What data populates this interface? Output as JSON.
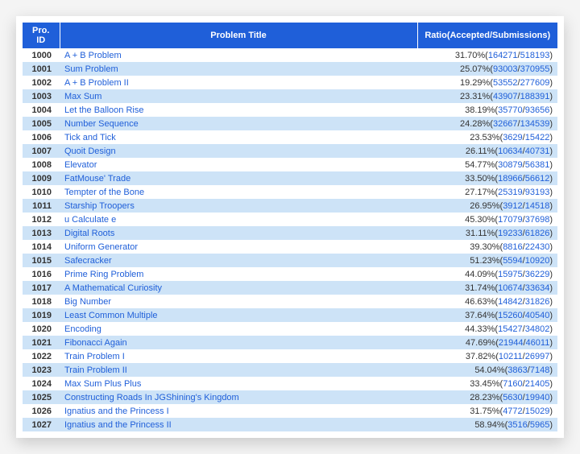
{
  "columns": {
    "id": "Pro. ID",
    "title": "Problem Title",
    "ratio": "Ratio(Accepted/Submissions)"
  },
  "rows": [
    {
      "id": "1000",
      "title": "A + B Problem",
      "ratio": "31.70%",
      "accepted": "164271",
      "submissions": "518193"
    },
    {
      "id": "1001",
      "title": "Sum Problem",
      "ratio": "25.07%",
      "accepted": "93003",
      "submissions": "370955"
    },
    {
      "id": "1002",
      "title": "A + B Problem II",
      "ratio": "19.29%",
      "accepted": "53552",
      "submissions": "277609"
    },
    {
      "id": "1003",
      "title": "Max Sum",
      "ratio": "23.31%",
      "accepted": "43907",
      "submissions": "188391"
    },
    {
      "id": "1004",
      "title": "Let the Balloon Rise",
      "ratio": "38.19%",
      "accepted": "35770",
      "submissions": "93656"
    },
    {
      "id": "1005",
      "title": "Number Sequence",
      "ratio": "24.28%",
      "accepted": "32667",
      "submissions": "134539"
    },
    {
      "id": "1006",
      "title": "Tick and Tick",
      "ratio": "23.53%",
      "accepted": "3629",
      "submissions": "15422"
    },
    {
      "id": "1007",
      "title": "Quoit Design",
      "ratio": "26.11%",
      "accepted": "10634",
      "submissions": "40731"
    },
    {
      "id": "1008",
      "title": "Elevator",
      "ratio": "54.77%",
      "accepted": "30879",
      "submissions": "56381"
    },
    {
      "id": "1009",
      "title": "FatMouse' Trade",
      "ratio": "33.50%",
      "accepted": "18966",
      "submissions": "56612"
    },
    {
      "id": "1010",
      "title": "Tempter of the Bone",
      "ratio": "27.17%",
      "accepted": "25319",
      "submissions": "93193"
    },
    {
      "id": "1011",
      "title": "Starship Troopers",
      "ratio": "26.95%",
      "accepted": "3912",
      "submissions": "14518"
    },
    {
      "id": "1012",
      "title": "u Calculate e",
      "ratio": "45.30%",
      "accepted": "17079",
      "submissions": "37698"
    },
    {
      "id": "1013",
      "title": "Digital Roots",
      "ratio": "31.11%",
      "accepted": "19233",
      "submissions": "61826"
    },
    {
      "id": "1014",
      "title": "Uniform Generator",
      "ratio": "39.30%",
      "accepted": "8816",
      "submissions": "22430"
    },
    {
      "id": "1015",
      "title": "Safecracker",
      "ratio": "51.23%",
      "accepted": "5594",
      "submissions": "10920"
    },
    {
      "id": "1016",
      "title": "Prime Ring Problem",
      "ratio": "44.09%",
      "accepted": "15975",
      "submissions": "36229"
    },
    {
      "id": "1017",
      "title": "A Mathematical Curiosity",
      "ratio": "31.74%",
      "accepted": "10674",
      "submissions": "33634"
    },
    {
      "id": "1018",
      "title": "Big Number",
      "ratio": "46.63%",
      "accepted": "14842",
      "submissions": "31826"
    },
    {
      "id": "1019",
      "title": "Least Common Multiple",
      "ratio": "37.64%",
      "accepted": "15260",
      "submissions": "40540"
    },
    {
      "id": "1020",
      "title": "Encoding",
      "ratio": "44.33%",
      "accepted": "15427",
      "submissions": "34802"
    },
    {
      "id": "1021",
      "title": "Fibonacci Again",
      "ratio": "47.69%",
      "accepted": "21944",
      "submissions": "46011"
    },
    {
      "id": "1022",
      "title": "Train Problem I",
      "ratio": "37.82%",
      "accepted": "10211",
      "submissions": "26997"
    },
    {
      "id": "1023",
      "title": "Train Problem II",
      "ratio": "54.04%",
      "accepted": "3863",
      "submissions": "7148"
    },
    {
      "id": "1024",
      "title": "Max Sum Plus Plus",
      "ratio": "33.45%",
      "accepted": "7160",
      "submissions": "21405"
    },
    {
      "id": "1025",
      "title": "Constructing Roads In JGShining's Kingdom",
      "ratio": "28.23%",
      "accepted": "5630",
      "submissions": "19940"
    },
    {
      "id": "1026",
      "title": "Ignatius and the Princess I",
      "ratio": "31.75%",
      "accepted": "4772",
      "submissions": "15029"
    },
    {
      "id": "1027",
      "title": "Ignatius and the Princess II",
      "ratio": "58.94%",
      "accepted": "3516",
      "submissions": "5965"
    }
  ]
}
